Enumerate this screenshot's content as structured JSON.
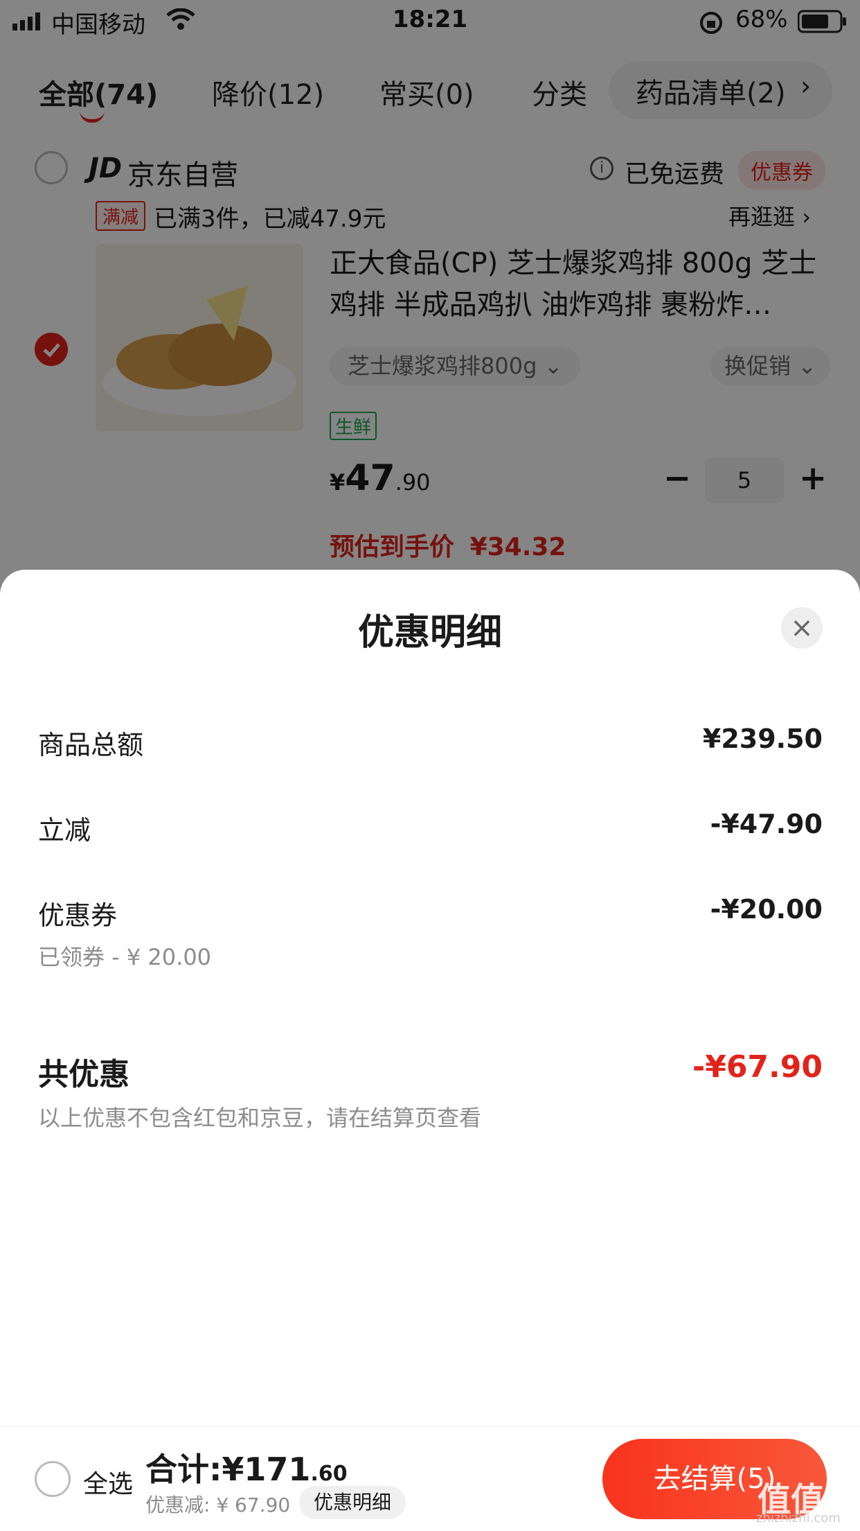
{
  "status_bar": {
    "carrier": "中国移动",
    "time": "18:21",
    "battery": "68%"
  },
  "tabs": [
    {
      "label": "全部(74)"
    },
    {
      "label": "降价(12)"
    },
    {
      "label": "常买(0)"
    },
    {
      "label": "分类"
    },
    {
      "label": "药品清单(2)"
    }
  ],
  "store": {
    "logo": "JD",
    "name": "京东自营",
    "shipping": "已免运费",
    "coupon_tag": "优惠券",
    "promo_tag": "满减",
    "promo_text": "已满3件，已减47.9元",
    "more": "再逛逛"
  },
  "product": {
    "title": "正大食品(CP) 芝士爆浆鸡排 800g 芝士鸡排 半成品鸡扒 油炸鸡排 裹粉炸…",
    "spec": "芝士爆浆鸡排800g",
    "promo_switch": "换促销",
    "tag": "生鲜",
    "price_symbol": "¥",
    "price_int": "47",
    "price_dec": ".90",
    "quantity": "5",
    "est_label": "预估到手价",
    "est_price": "¥34.32"
  },
  "sheet": {
    "title": "优惠明细",
    "rows": [
      {
        "label": "商品总额",
        "value": "¥239.50"
      },
      {
        "label": "立减",
        "value": "-¥47.90"
      },
      {
        "label": "优惠券",
        "value": "-¥20.00",
        "sub": "已领券 - ¥ 20.00"
      }
    ],
    "total_label": "共优惠",
    "total_value": "-¥67.90",
    "note": "以上优惠不包含红包和京豆，请在结算页查看"
  },
  "bottom_bar": {
    "select_all": "全选",
    "total_prefix": "合计:¥171",
    "total_dec": ".60",
    "saved": "优惠减: ¥ 67.90",
    "detail_chip": "优惠明细",
    "checkout": "去结算(5)"
  },
  "watermark": {
    "text": "值值值",
    "sub": "zhizhizhi.com"
  },
  "colors": {
    "accent": "#e2231a",
    "green_tag": "#1aa64f"
  }
}
